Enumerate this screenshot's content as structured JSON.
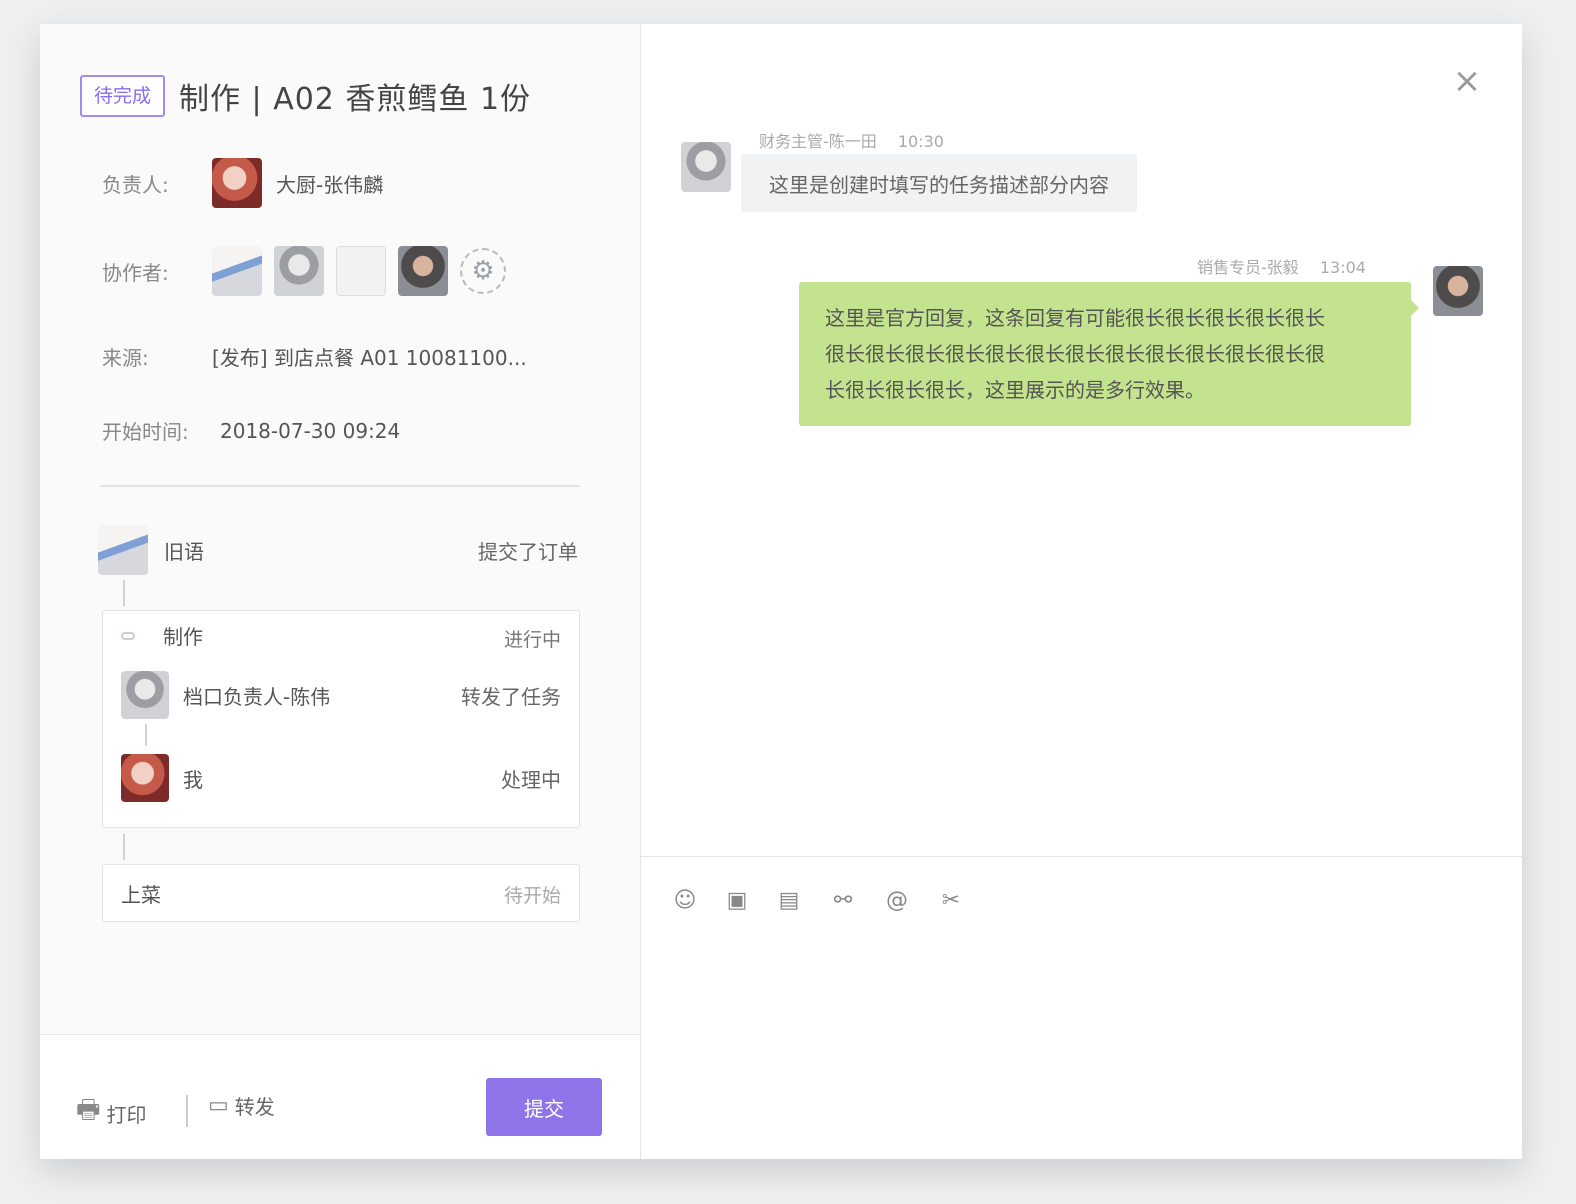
{
  "task": {
    "status_tag": "待完成",
    "title": "制作 | A02 香煎鳕鱼 1份"
  },
  "info": {
    "owner_label": "负责人:",
    "owner_name": "大厨-张伟麟",
    "collab_label": "协作者:",
    "source_label": "来源:",
    "source_value": "[发布] 到店点餐 A01 10081100...",
    "start_label": "开始时间:",
    "start_value": "2018-07-30 09:24"
  },
  "timeline": {
    "head": {
      "name": "旧语",
      "action": "提交了订单"
    },
    "card1": {
      "title": "制作",
      "status": "进行中",
      "rows": [
        {
          "name": "档口负责人-陈伟",
          "action": "转发了任务"
        },
        {
          "name": "我",
          "action": "处理中"
        }
      ]
    },
    "card2": {
      "title": "上菜",
      "status": "待开始"
    }
  },
  "footer": {
    "print_label": "打印",
    "forward_label": "转发",
    "submit_label": "提交"
  },
  "chat": {
    "close_icon": "×",
    "msg1": {
      "sender": "财务主管-陈一田",
      "time": "10:30",
      "text": "这里是创建时填写的任务描述部分内容"
    },
    "msg2": {
      "sender": "销售专员-张毅",
      "time": "13:04",
      "lines": [
        "这里是官方回复，这条回复有可能很长很长很长很长很长",
        "很长很长很长很长很长很长很长很长很长很长很长很长很",
        "长很长很长很长，这里展示的是多行效果。"
      ]
    }
  },
  "toolbar_icons": [
    "emoji-icon",
    "image-icon",
    "folder-icon",
    "link-icon",
    "at-icon",
    "screenshot-icon"
  ],
  "colors": {
    "accent": "#8e74e8",
    "bubble_self": "#c3e38e",
    "bubble_other": "#f1f2f4",
    "processing": "#f0a35a"
  }
}
